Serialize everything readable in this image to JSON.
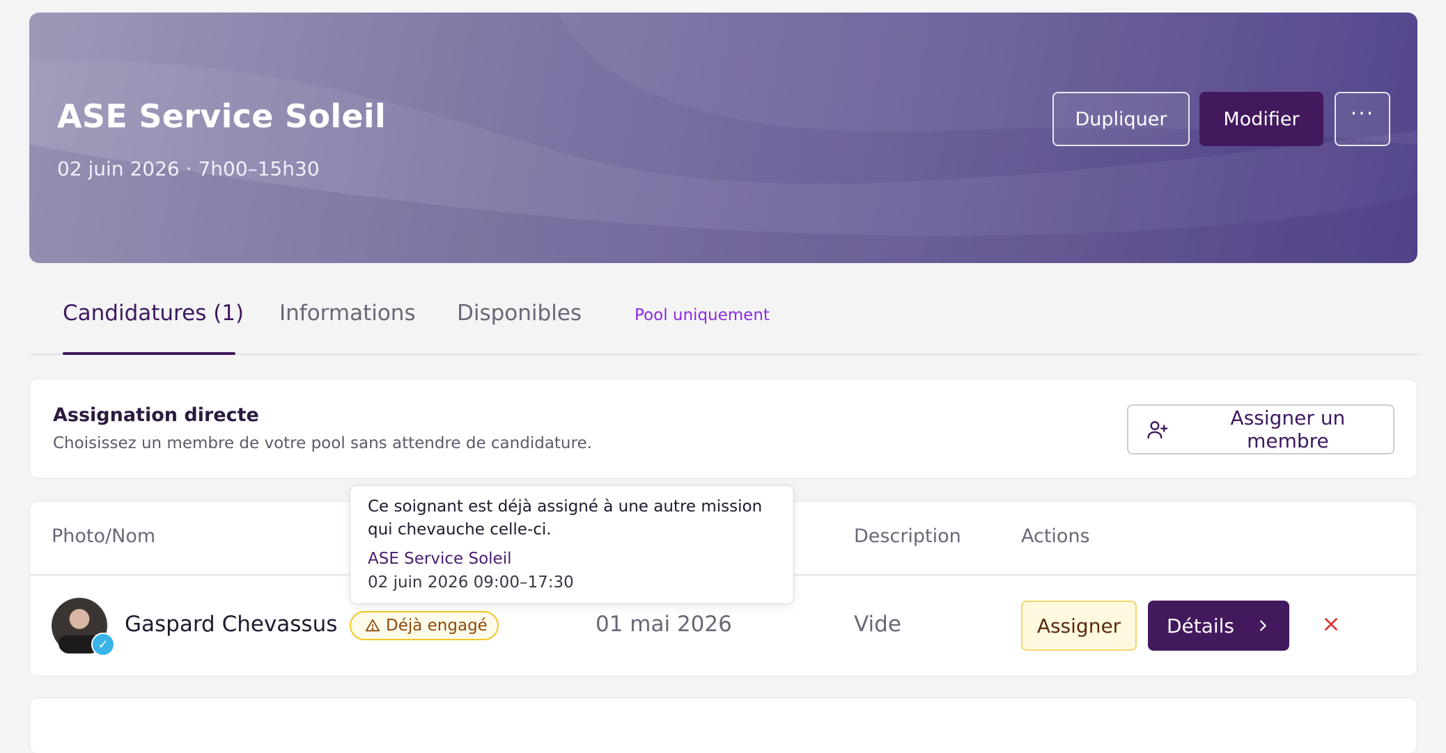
{
  "header": {
    "title": "ASE Service Soleil",
    "subtitle": "02 juin 2026 · 7h00–15h30",
    "duplicate_label": "Dupliquer",
    "edit_label": "Modifier",
    "more_label": "···"
  },
  "tabs": [
    {
      "label": "Candidatures (1)",
      "active": true
    },
    {
      "label": "Informations",
      "active": false
    },
    {
      "label": "Disponibles",
      "active": false
    }
  ],
  "pool_filter_label": "Pool uniquement",
  "direct_assignment": {
    "title": "Assignation directe",
    "description": "Choisissez un membre de votre pool sans attendre de candidature.",
    "button_label": "Assigner un membre"
  },
  "table": {
    "headers": [
      "Photo/Nom",
      "Description",
      "Actions"
    ],
    "rows": [
      {
        "name": "Gaspard Chevassus",
        "badge": "Déjà engagé",
        "date": "01 mai 2026",
        "description": "Vide",
        "assign_label": "Assigner",
        "details_label": "Détails"
      }
    ]
  },
  "tooltip": {
    "message": "Ce soignant est déjà assigné à une autre mission qui chevauche celle-ci.",
    "mission": "ASE Service Soleil",
    "time": "02 juin 2026 09:00–17:30"
  },
  "colors": {
    "primary": "#43195e",
    "accent_purple": "#8a2be2",
    "warning": "#f3c623",
    "danger": "#e03131",
    "verified": "#39b3e8"
  },
  "icons": {
    "more": "more-horizontal-icon",
    "assign_member": "user-plus-icon",
    "warning": "warning-triangle-icon",
    "details": "chevron-right-icon",
    "remove": "close-icon",
    "verified": "verified-check-icon"
  }
}
